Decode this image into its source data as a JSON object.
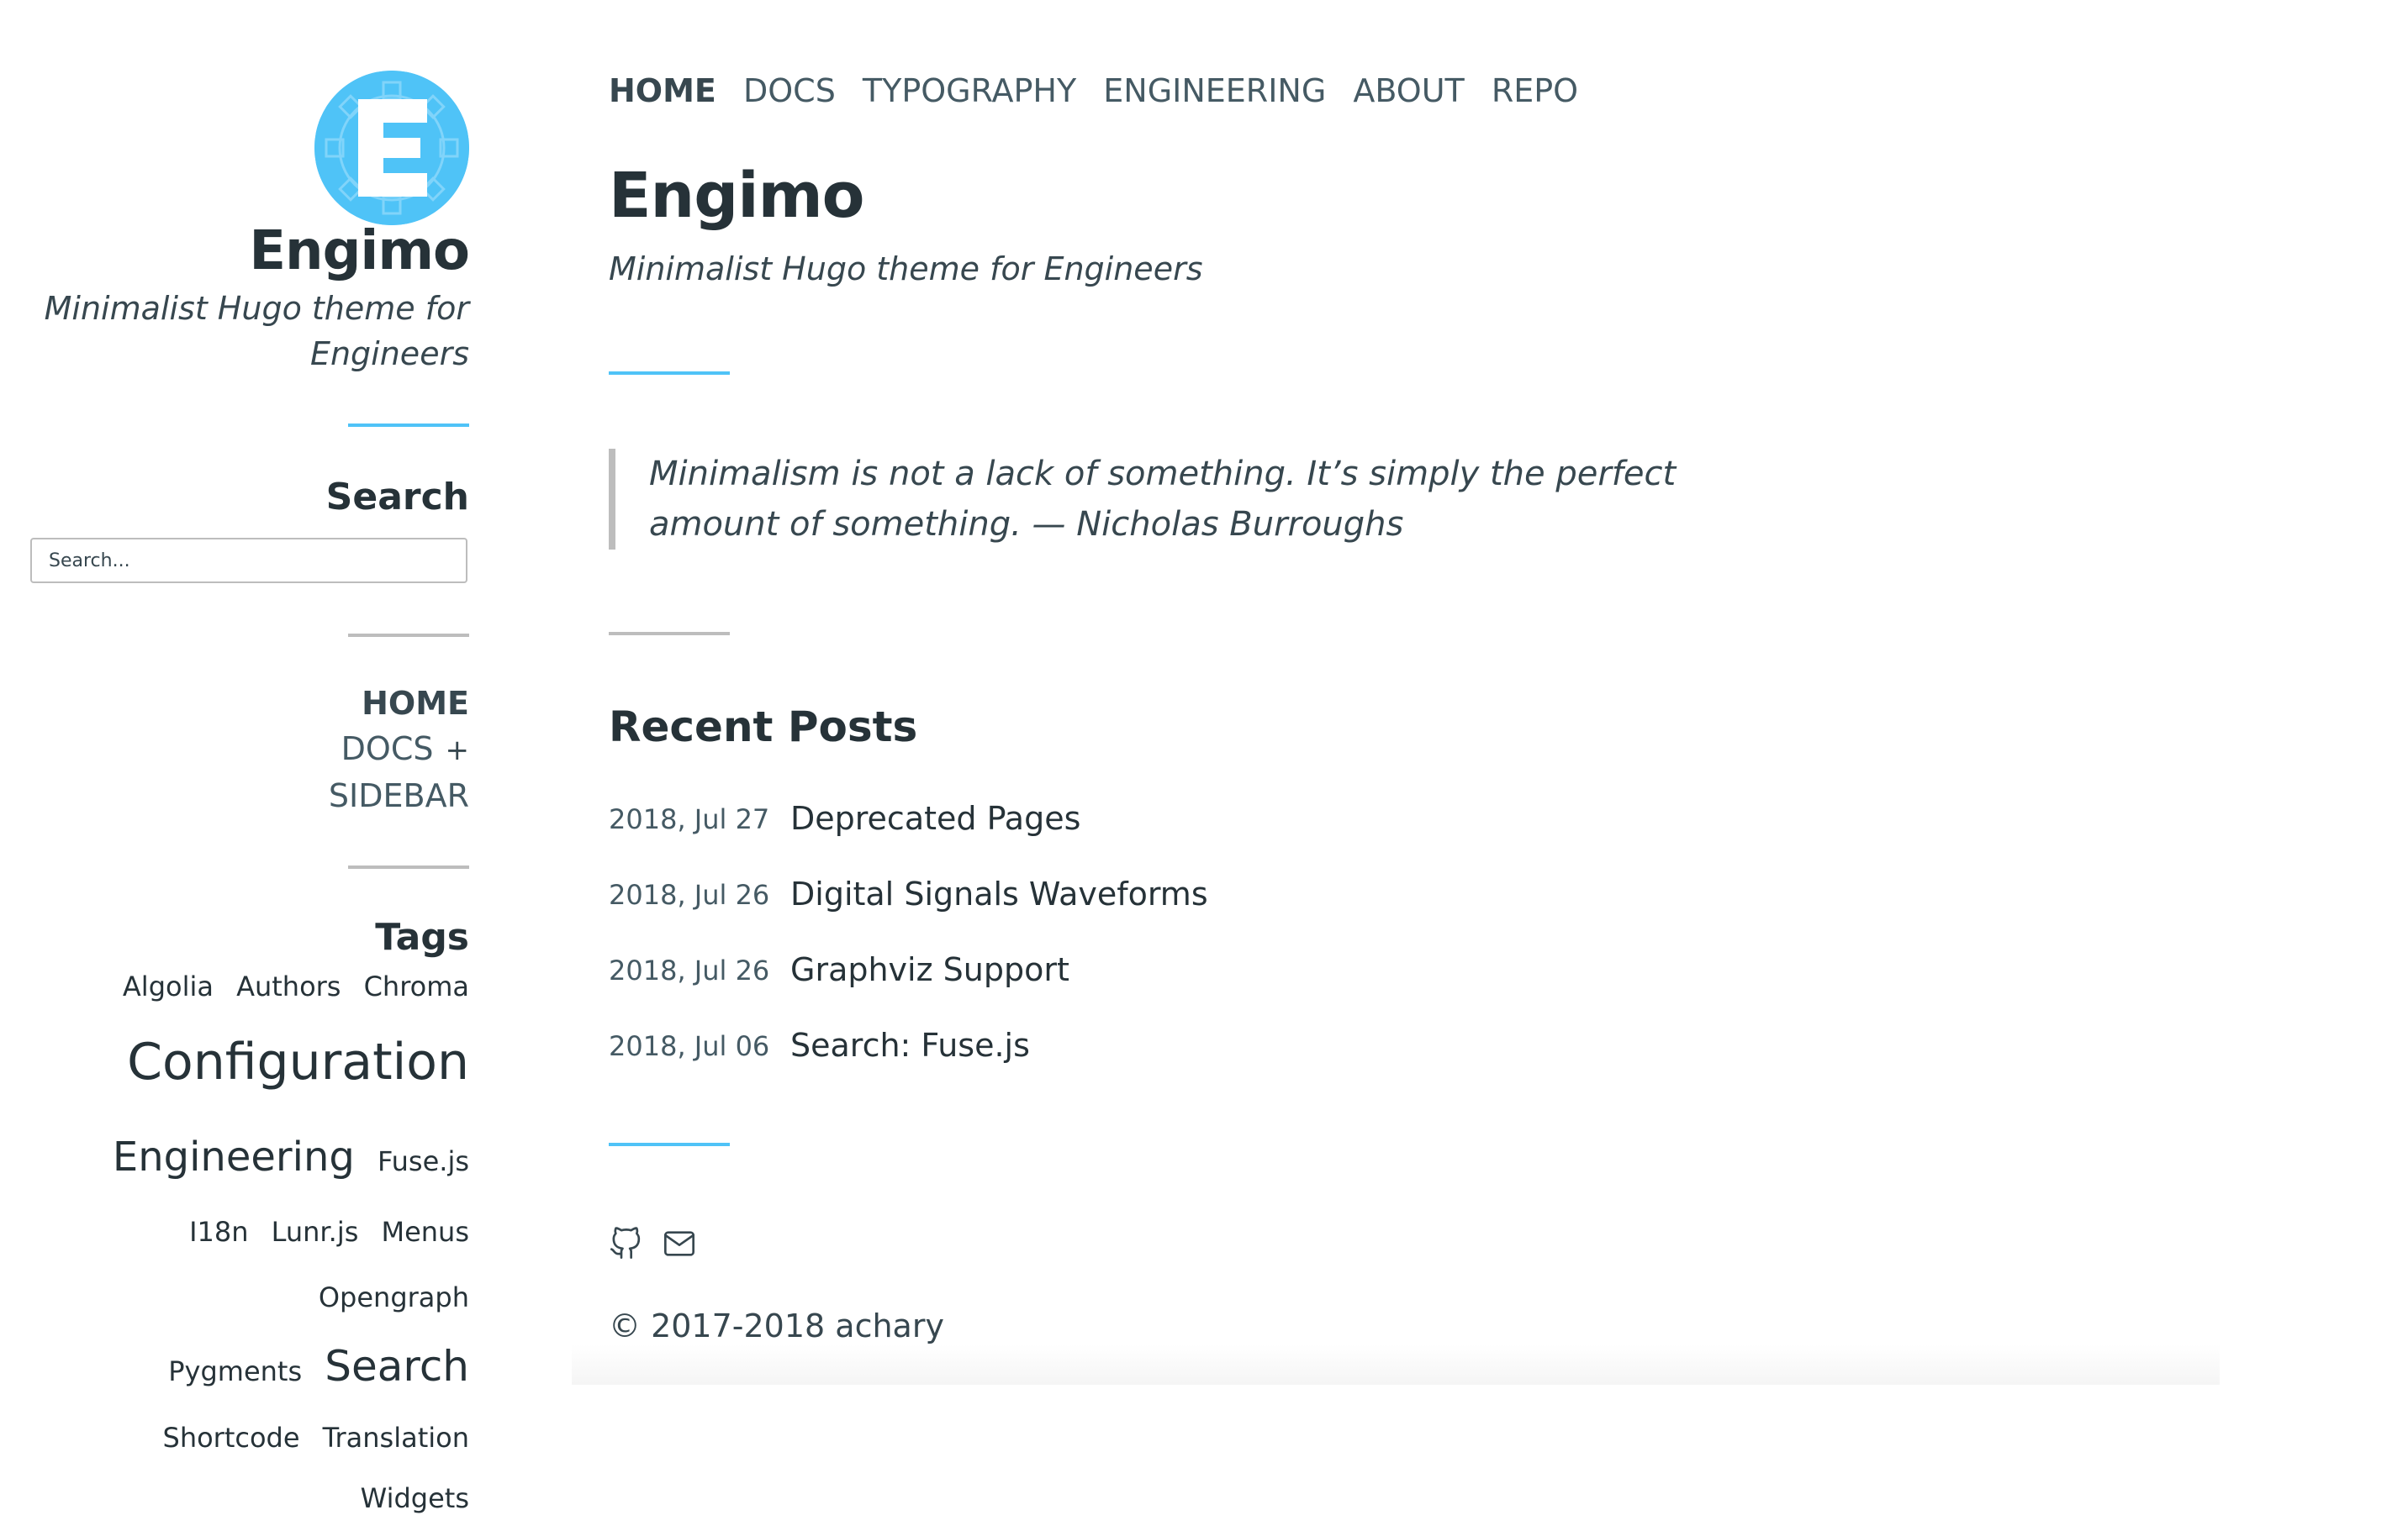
{
  "sidebar": {
    "title": "Engimo",
    "subtitle": "Minimalist Hugo theme for Engineers",
    "search_heading": "Search",
    "search_placeholder": "Search...",
    "menu": [
      {
        "label": "HOME",
        "active": true
      },
      {
        "label": "DOCS",
        "expand": "+"
      },
      {
        "label": "SIDEBAR"
      }
    ],
    "tags_heading": "Tags",
    "tags": [
      {
        "label": "Algolia",
        "size": "small"
      },
      {
        "label": "Authors",
        "size": "small"
      },
      {
        "label": "Chroma",
        "size": "small"
      },
      {
        "label": "Configuration",
        "size": "large"
      },
      {
        "label": "Engineering",
        "size": "medium"
      },
      {
        "label": "Fuse.js",
        "size": "small"
      },
      {
        "label": "I18n",
        "size": "small"
      },
      {
        "label": "Lunr.js",
        "size": "small"
      },
      {
        "label": "Menus",
        "size": "small"
      },
      {
        "label": "Opengraph",
        "size": "small"
      },
      {
        "label": "Pygments",
        "size": "small"
      },
      {
        "label": "Search",
        "size": "medium"
      },
      {
        "label": "Shortcode",
        "size": "small"
      },
      {
        "label": "Translation",
        "size": "small"
      },
      {
        "label": "Widgets",
        "size": "small"
      }
    ]
  },
  "topnav": [
    {
      "label": "HOME",
      "active": true
    },
    {
      "label": "DOCS"
    },
    {
      "label": "TYPOGRAPHY"
    },
    {
      "label": "ENGINEERING"
    },
    {
      "label": "ABOUT"
    },
    {
      "label": "REPO"
    }
  ],
  "main": {
    "title": "Engimo",
    "subtitle": "Minimalist Hugo theme for Engineers",
    "quote": "Minimalism is not a lack of something. It’s simply the perfect amount of something. — Nicholas Burroughs",
    "recent_heading": "Recent Posts",
    "posts": [
      {
        "date": "2018, Jul 27",
        "title": "Deprecated Pages"
      },
      {
        "date": "2018, Jul 26",
        "title": "Digital Signals Waveforms"
      },
      {
        "date": "2018, Jul 26",
        "title": "Graphviz Support"
      },
      {
        "date": "2018, Jul 06",
        "title": "Search: Fuse.js"
      }
    ],
    "social_icons": [
      "github-icon",
      "mail-icon"
    ],
    "copyright": "© 2017-2018 achary"
  },
  "colors": {
    "accent": "#4fc3f7",
    "text": "#263238",
    "muted": "#455a64",
    "rule_gray": "#bdbdbd"
  }
}
